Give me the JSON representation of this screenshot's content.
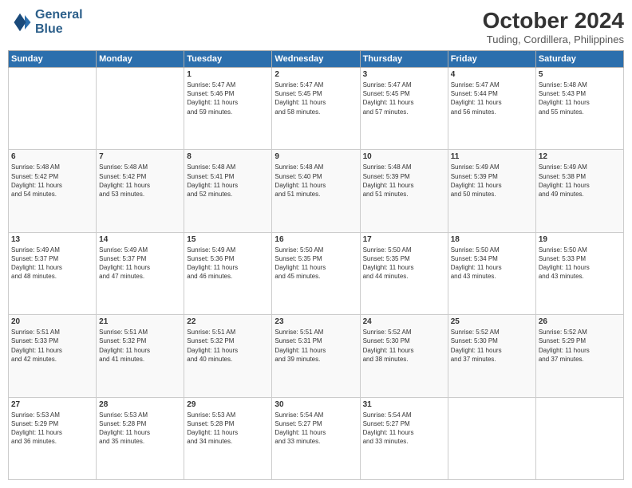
{
  "logo": {
    "line1": "General",
    "line2": "Blue"
  },
  "title": "October 2024",
  "location": "Tuding, Cordillera, Philippines",
  "headers": [
    "Sunday",
    "Monday",
    "Tuesday",
    "Wednesday",
    "Thursday",
    "Friday",
    "Saturday"
  ],
  "weeks": [
    [
      {
        "day": "",
        "content": ""
      },
      {
        "day": "",
        "content": ""
      },
      {
        "day": "1",
        "content": "Sunrise: 5:47 AM\nSunset: 5:46 PM\nDaylight: 11 hours\nand 59 minutes."
      },
      {
        "day": "2",
        "content": "Sunrise: 5:47 AM\nSunset: 5:45 PM\nDaylight: 11 hours\nand 58 minutes."
      },
      {
        "day": "3",
        "content": "Sunrise: 5:47 AM\nSunset: 5:45 PM\nDaylight: 11 hours\nand 57 minutes."
      },
      {
        "day": "4",
        "content": "Sunrise: 5:47 AM\nSunset: 5:44 PM\nDaylight: 11 hours\nand 56 minutes."
      },
      {
        "day": "5",
        "content": "Sunrise: 5:48 AM\nSunset: 5:43 PM\nDaylight: 11 hours\nand 55 minutes."
      }
    ],
    [
      {
        "day": "6",
        "content": "Sunrise: 5:48 AM\nSunset: 5:42 PM\nDaylight: 11 hours\nand 54 minutes."
      },
      {
        "day": "7",
        "content": "Sunrise: 5:48 AM\nSunset: 5:42 PM\nDaylight: 11 hours\nand 53 minutes."
      },
      {
        "day": "8",
        "content": "Sunrise: 5:48 AM\nSunset: 5:41 PM\nDaylight: 11 hours\nand 52 minutes."
      },
      {
        "day": "9",
        "content": "Sunrise: 5:48 AM\nSunset: 5:40 PM\nDaylight: 11 hours\nand 51 minutes."
      },
      {
        "day": "10",
        "content": "Sunrise: 5:48 AM\nSunset: 5:39 PM\nDaylight: 11 hours\nand 51 minutes."
      },
      {
        "day": "11",
        "content": "Sunrise: 5:49 AM\nSunset: 5:39 PM\nDaylight: 11 hours\nand 50 minutes."
      },
      {
        "day": "12",
        "content": "Sunrise: 5:49 AM\nSunset: 5:38 PM\nDaylight: 11 hours\nand 49 minutes."
      }
    ],
    [
      {
        "day": "13",
        "content": "Sunrise: 5:49 AM\nSunset: 5:37 PM\nDaylight: 11 hours\nand 48 minutes."
      },
      {
        "day": "14",
        "content": "Sunrise: 5:49 AM\nSunset: 5:37 PM\nDaylight: 11 hours\nand 47 minutes."
      },
      {
        "day": "15",
        "content": "Sunrise: 5:49 AM\nSunset: 5:36 PM\nDaylight: 11 hours\nand 46 minutes."
      },
      {
        "day": "16",
        "content": "Sunrise: 5:50 AM\nSunset: 5:35 PM\nDaylight: 11 hours\nand 45 minutes."
      },
      {
        "day": "17",
        "content": "Sunrise: 5:50 AM\nSunset: 5:35 PM\nDaylight: 11 hours\nand 44 minutes."
      },
      {
        "day": "18",
        "content": "Sunrise: 5:50 AM\nSunset: 5:34 PM\nDaylight: 11 hours\nand 43 minutes."
      },
      {
        "day": "19",
        "content": "Sunrise: 5:50 AM\nSunset: 5:33 PM\nDaylight: 11 hours\nand 43 minutes."
      }
    ],
    [
      {
        "day": "20",
        "content": "Sunrise: 5:51 AM\nSunset: 5:33 PM\nDaylight: 11 hours\nand 42 minutes."
      },
      {
        "day": "21",
        "content": "Sunrise: 5:51 AM\nSunset: 5:32 PM\nDaylight: 11 hours\nand 41 minutes."
      },
      {
        "day": "22",
        "content": "Sunrise: 5:51 AM\nSunset: 5:32 PM\nDaylight: 11 hours\nand 40 minutes."
      },
      {
        "day": "23",
        "content": "Sunrise: 5:51 AM\nSunset: 5:31 PM\nDaylight: 11 hours\nand 39 minutes."
      },
      {
        "day": "24",
        "content": "Sunrise: 5:52 AM\nSunset: 5:30 PM\nDaylight: 11 hours\nand 38 minutes."
      },
      {
        "day": "25",
        "content": "Sunrise: 5:52 AM\nSunset: 5:30 PM\nDaylight: 11 hours\nand 37 minutes."
      },
      {
        "day": "26",
        "content": "Sunrise: 5:52 AM\nSunset: 5:29 PM\nDaylight: 11 hours\nand 37 minutes."
      }
    ],
    [
      {
        "day": "27",
        "content": "Sunrise: 5:53 AM\nSunset: 5:29 PM\nDaylight: 11 hours\nand 36 minutes."
      },
      {
        "day": "28",
        "content": "Sunrise: 5:53 AM\nSunset: 5:28 PM\nDaylight: 11 hours\nand 35 minutes."
      },
      {
        "day": "29",
        "content": "Sunrise: 5:53 AM\nSunset: 5:28 PM\nDaylight: 11 hours\nand 34 minutes."
      },
      {
        "day": "30",
        "content": "Sunrise: 5:54 AM\nSunset: 5:27 PM\nDaylight: 11 hours\nand 33 minutes."
      },
      {
        "day": "31",
        "content": "Sunrise: 5:54 AM\nSunset: 5:27 PM\nDaylight: 11 hours\nand 33 minutes."
      },
      {
        "day": "",
        "content": ""
      },
      {
        "day": "",
        "content": ""
      }
    ]
  ]
}
